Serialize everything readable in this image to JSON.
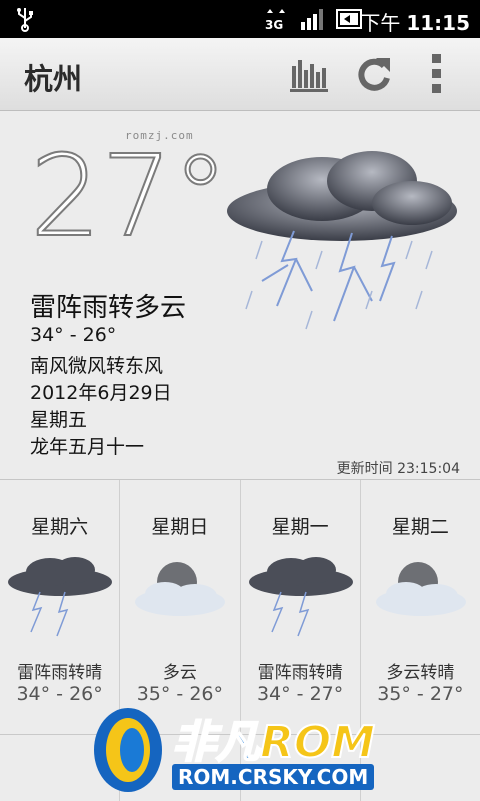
{
  "status_bar": {
    "network": "3G",
    "time_period": "下午",
    "time": "11:15",
    "icons": [
      "usb-icon",
      "network-3g-icon",
      "signal-icon",
      "battery-icon"
    ]
  },
  "action_bar": {
    "city": "杭州",
    "icons": [
      "chart-icon",
      "refresh-icon",
      "overflow-menu-icon"
    ]
  },
  "current": {
    "watermark": "romzj.com",
    "temperature": "27°",
    "condition": "雷阵雨转多云",
    "range": "34° - 26°",
    "wind": "南风微风转东风",
    "date": "2012年6月29日",
    "weekday": "星期五",
    "lunar_date": "龙年五月十一",
    "updated": "更新时间 23:15:04",
    "icon": "thunderstorm-icon"
  },
  "forecast": [
    {
      "day": "星期六",
      "condition": "雷阵雨转晴",
      "range": "34° - 26°",
      "icon": "thunderstorm-icon"
    },
    {
      "day": "星期日",
      "condition": "多云",
      "range": "35° - 26°",
      "icon": "cloudy-moon-icon"
    },
    {
      "day": "星期一",
      "condition": "雷阵雨转晴",
      "range": "34° - 27°",
      "icon": "thunderstorm-icon"
    },
    {
      "day": "星期二",
      "condition": "多云转晴",
      "range": "35° - 27°",
      "icon": "cloudy-moon-icon"
    }
  ],
  "logo": {
    "brand_part1": "非凡",
    "brand_part2": "ROM",
    "url": "ROM.CRSKY.COM"
  },
  "colors": {
    "background": "#ececec",
    "status_bar": "#000000",
    "logo_blue": "#1a7ad6",
    "logo_yellow": "#f5c518"
  }
}
